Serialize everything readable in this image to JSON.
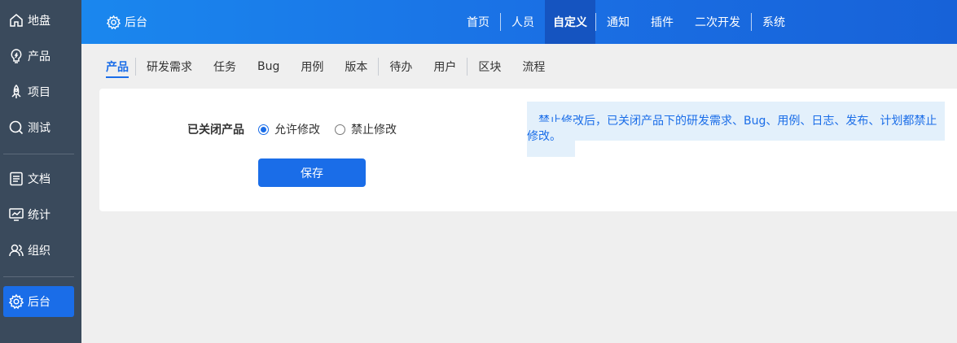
{
  "sidebar": {
    "items": [
      {
        "label": "地盘",
        "icon": "home-icon"
      },
      {
        "label": "产品",
        "icon": "lightbulb-icon"
      },
      {
        "label": "项目",
        "icon": "rocket-icon"
      },
      {
        "label": "测试",
        "icon": "search-icon"
      },
      {
        "label": "文档",
        "icon": "document-icon"
      },
      {
        "label": "统计",
        "icon": "monitor-chart-icon"
      },
      {
        "label": "组织",
        "icon": "users-icon"
      },
      {
        "label": "后台",
        "icon": "gear-icon",
        "active": true
      }
    ]
  },
  "header": {
    "brand": "后台",
    "nav": [
      "首页",
      "人员",
      "自定义",
      "通知",
      "插件",
      "二次开发",
      "系统"
    ],
    "active_nav": "自定义"
  },
  "subtabs": {
    "items": [
      "产品",
      "研发需求",
      "任务",
      "Bug",
      "用例",
      "版本",
      "待办",
      "用户",
      "区块",
      "流程"
    ],
    "active": "产品"
  },
  "form": {
    "field_label": "已关闭产品",
    "options": [
      "允许修改",
      "禁止修改"
    ],
    "selected": "允许修改",
    "save_label": "保存"
  },
  "tip": {
    "line1": "禁止修改后，已关闭产品下的研发需求、Bug、用例、日志、发布、计划都禁止",
    "line2": "修改。"
  },
  "colors": {
    "accent": "#1a6de8",
    "sidebar_bg": "#3a4a5c",
    "tip_bg": "#e3f0fb"
  }
}
